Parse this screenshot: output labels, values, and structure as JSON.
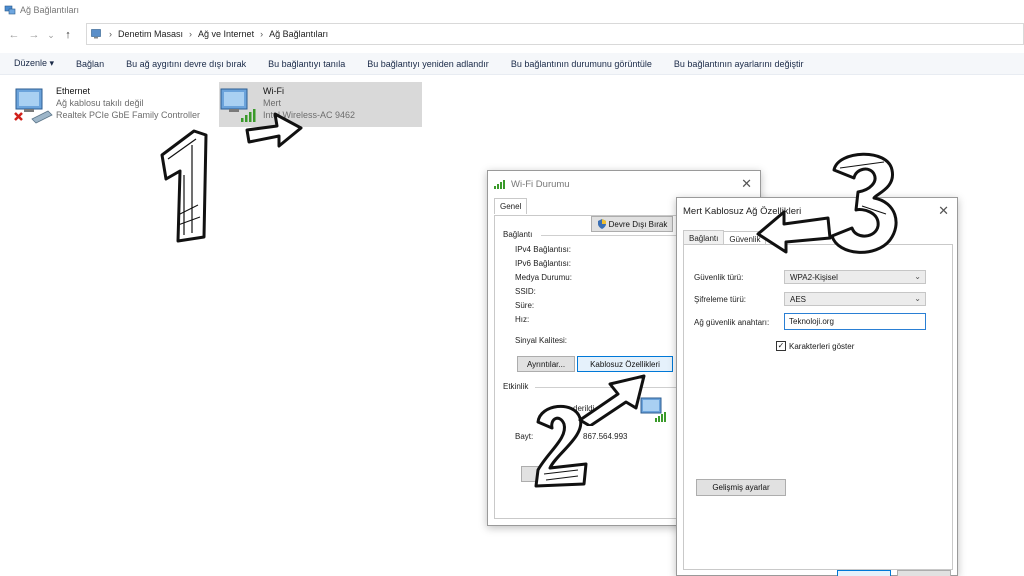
{
  "window": {
    "title": "Ağ Bağlantıları"
  },
  "nav": {
    "back": "←",
    "forward": "→",
    "recent": "⌄",
    "up": "↑"
  },
  "breadcrumb": [
    "Denetim Masası",
    "Ağ ve Internet",
    "Ağ Bağlantıları"
  ],
  "commands": [
    "Düzenle ▾",
    "Bağlan",
    "Bu ağ aygıtını devre dışı bırak",
    "Bu bağlantıyı tanıla",
    "Bu bağlantıyı yeniden adlandır",
    "Bu bağlantının durumunu görüntüle",
    "Bu bağlantının ayarlarını değiştir"
  ],
  "adapters": [
    {
      "name": "Ethernet",
      "status": "Ağ kablosu takılı değil",
      "device": "Realtek PCIe GbE Family Controller"
    },
    {
      "name": "Wi-Fi",
      "status": "Mert",
      "device": "Intel Wireless-AC 9462"
    }
  ],
  "wifi_status": {
    "title": "Wi-Fi Durumu",
    "tab": "Genel",
    "section_connection": "Bağlantı",
    "rows": [
      "IPv4 Bağlantısı:",
      "IPv6 Bağlantısı:",
      "Medya Durumu:",
      "SSID:",
      "Süre:",
      "Hız:"
    ],
    "signal": "Sinyal Kalitesi:",
    "details_button": "Ayrıntılar...",
    "wireless_props_button": "Kablosuz Özellikleri",
    "section_activity": "Etkinlik",
    "sent_partial": "derildi",
    "bytes_label": "Bayt:",
    "bytes_value": "867.564.993",
    "disable_button": "Devre Dışı Bırak"
  },
  "wireless_props": {
    "title": "Mert Kablosuz Ağ Özellikleri",
    "tabs": [
      "Bağlantı",
      "Güvenlik"
    ],
    "security_type_label": "Güvenlik türü:",
    "security_type_value": "WPA2-Kişisel",
    "encryption_label": "Şifreleme türü:",
    "encryption_value": "AES",
    "key_label": "Ağ güvenlik anahtarı:",
    "key_value": "Teknoloji.org",
    "show_chars": "Karakterleri göster",
    "advanced_button": "Gelişmiş ayarlar"
  },
  "annotations": [
    "1",
    "2",
    "3"
  ],
  "colors": {
    "selection": "#d9d9d9",
    "focus": "#0078d7",
    "signal": "#3a9a2a",
    "error": "#d0201a"
  }
}
